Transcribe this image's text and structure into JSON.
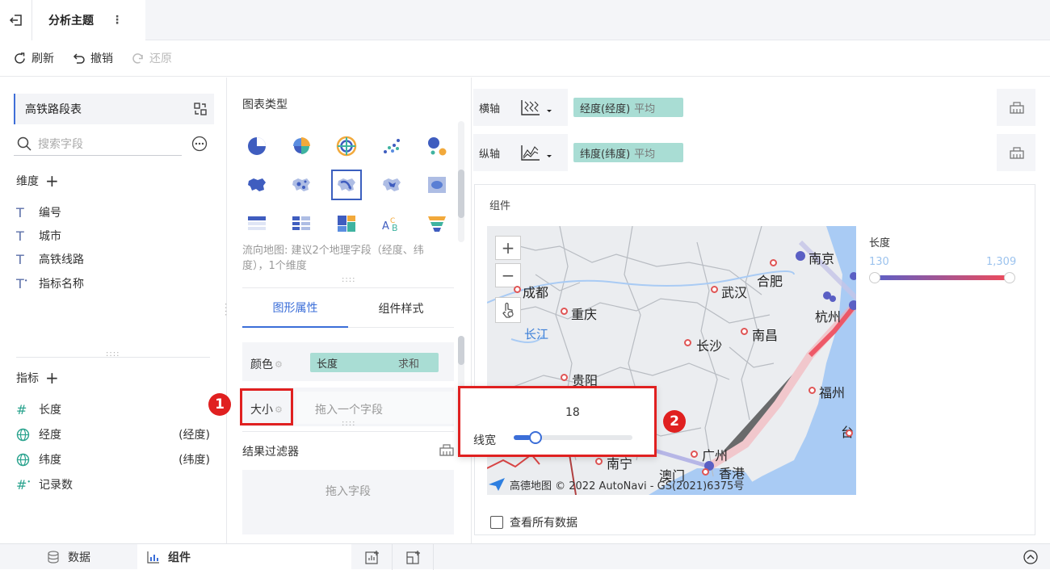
{
  "topbar": {
    "title": "分析主题",
    "more": "⋮"
  },
  "toolbar": {
    "refresh": "刷新",
    "undo": "撤销",
    "redo": "还原"
  },
  "left": {
    "dataset": "高铁路段表",
    "search_placeholder": "搜索字段",
    "dimensions_label": "维度",
    "dimensions": [
      {
        "label": "编号"
      },
      {
        "label": "城市"
      },
      {
        "label": "高铁线路"
      },
      {
        "label": "指标名称"
      }
    ],
    "measures_label": "指标",
    "measures": [
      {
        "label": "长度",
        "suffix": ""
      },
      {
        "label": "经度",
        "suffix": "(经度)"
      },
      {
        "label": "纬度",
        "suffix": "(纬度)"
      },
      {
        "label": "记录数",
        "suffix": ""
      }
    ]
  },
  "mid": {
    "chart_type_label": "图表类型",
    "chart_desc": "流向地图: 建议2个地理字段（经度、纬度），1个维度",
    "tabs": [
      "图形属性",
      "组件样式"
    ],
    "color_label": "颜色",
    "color_field": "长度",
    "color_agg": "求和",
    "size_label": "大小",
    "size_placeholder": "拖入一个字段",
    "filter_label": "结果过滤器",
    "filter_placeholder": "拖入字段"
  },
  "popup": {
    "value": "18",
    "label": "线宽",
    "slider_fraction": 0.14
  },
  "axes": {
    "x_label": "横轴",
    "x_field": "经度(经度)",
    "x_agg": "平均",
    "y_label": "纵轴",
    "y_field": "纬度(纬度)",
    "y_agg": "平均"
  },
  "component": {
    "title": "组件",
    "legend_title": "长度",
    "legend_min": "130",
    "legend_max": "1,309",
    "show_all": "查看所有数据",
    "attribution": "高德地图 © 2022 AutoNavi - GS(2021)6375号",
    "zoom_in": "+",
    "zoom_out": "−",
    "cities": [
      "南京",
      "成都",
      "武汉",
      "合肥",
      "重庆",
      "杭州",
      "长江",
      "长沙",
      "南昌",
      "贵阳",
      "福州",
      "广州",
      "香港",
      "澳门",
      "南宁",
      "台"
    ]
  },
  "bottom": {
    "data_tab": "数据",
    "component_tab": "组件"
  },
  "badges": [
    "1",
    "2"
  ],
  "colors": {
    "accent": "#3b6ed8",
    "pill": "#a9ddd4",
    "annotation": "#e02020"
  }
}
